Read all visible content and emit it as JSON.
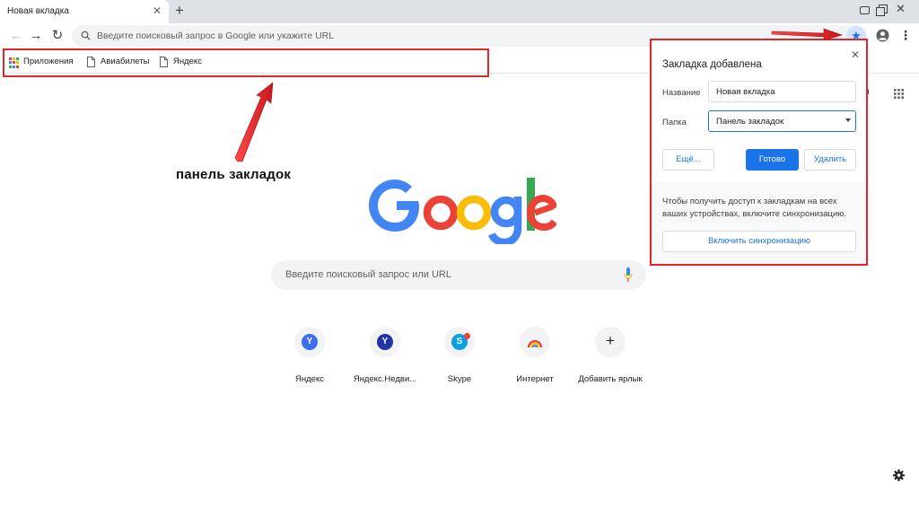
{
  "tab": {
    "title": "Новая вкладка",
    "close": "✕",
    "new_tab": "+"
  },
  "window": {
    "close": "✕"
  },
  "toolbar": {
    "back": "←",
    "forward": "→",
    "reload": "↻",
    "omnibox_placeholder": "Введите поисковый запрос в Google или укажите URL",
    "star": "★",
    "menu": "⋮"
  },
  "bookmarks_bar": {
    "items": [
      {
        "label": "Приложения",
        "icon": "apps-grid-icon"
      },
      {
        "label": "Авиабилеты",
        "icon": "page-icon"
      },
      {
        "label": "Яндекс",
        "icon": "page-icon"
      }
    ]
  },
  "annotation": {
    "label": "панель закладок",
    "color": "#e3262b"
  },
  "ntp": {
    "right_text_partial": "ки",
    "search_placeholder": "Введите поисковый запрос или URL",
    "shortcuts": [
      {
        "label": "Яндекс",
        "glyph": "Y",
        "color": "#3c6ef0"
      },
      {
        "label": "Яндекс.Недви...",
        "glyph": "Y",
        "color": "#2633a8"
      },
      {
        "label": "Skype",
        "glyph": "S",
        "color": "#0a9fe6"
      },
      {
        "label": "Интернет",
        "glyph": "",
        "color": "#e8eaed"
      },
      {
        "label": "Добавить ярлык",
        "glyph": "+",
        "color": "#f1f3f4"
      }
    ]
  },
  "popup": {
    "title": "Закладка добавлена",
    "close": "✕",
    "name_label": "Название",
    "name_value": "Новая вкладка",
    "folder_label": "Папка",
    "folder_value": "Панель закладок",
    "more_button": "Ещё...",
    "done_button": "Готово",
    "remove_button": "Удалить",
    "sync_text": "Чтобы получить доступ к закладкам на всех ваших устройствах, включите синхронизацию.",
    "sync_button": "Включить синхронизацию"
  },
  "colors": {
    "accent": "#1a73e8",
    "highlight": "#e3262b",
    "google_blue": "#4285f4",
    "google_red": "#ea4335",
    "google_yellow": "#fbbc05",
    "google_green": "#34a853"
  }
}
